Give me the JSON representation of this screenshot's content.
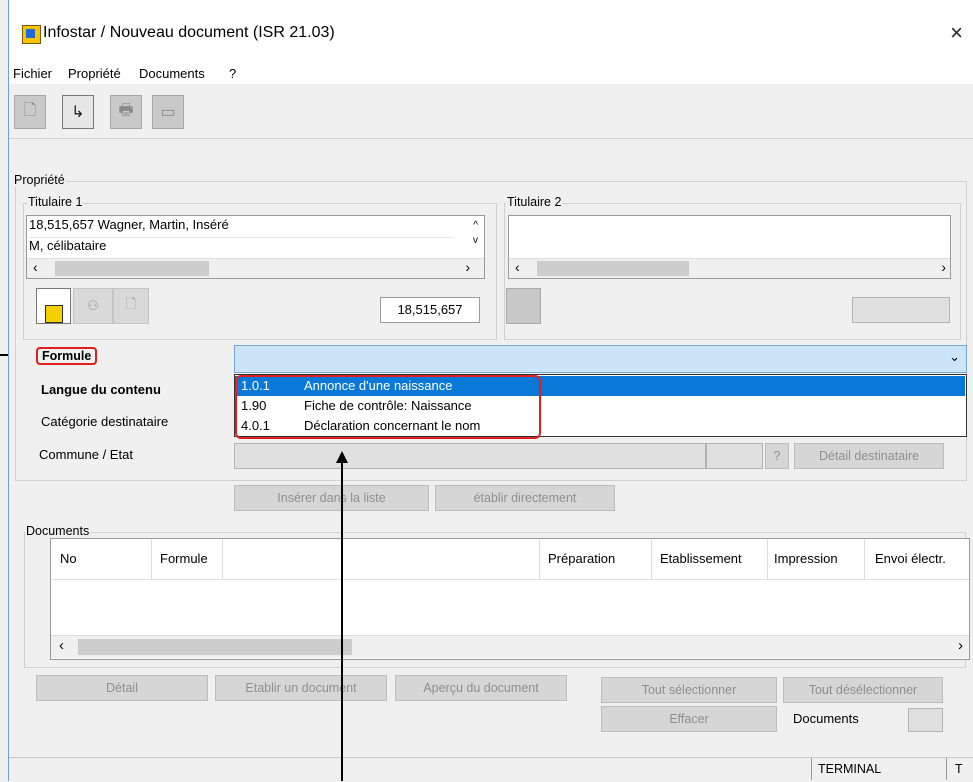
{
  "window": {
    "title": "Infostar / Nouveau document (ISR 21.03)",
    "close_glyph": "×"
  },
  "menu": [
    "Fichier",
    "Propriété",
    "Documents",
    "?"
  ],
  "toolbar": [
    {
      "icon": "new-document-icon",
      "glyph": "🗋"
    },
    {
      "icon": "exit-door-icon",
      "glyph": "↳"
    },
    {
      "icon": "printer-icon",
      "glyph": "🖶"
    },
    {
      "icon": "card-icon",
      "glyph": "▭"
    }
  ],
  "propriete": {
    "label": "Propriété",
    "titulaire1": {
      "label": "Titulaire 1",
      "line1": "18,515,657  Wagner, Martin, Inséré",
      "line2": "M, célibataire",
      "id": "18,515,657"
    },
    "titulaire2": {
      "label": "Titulaire 2",
      "id": ""
    }
  },
  "form": {
    "formule_label": "Formule",
    "langue_label": "Langue du contenu",
    "categorie_label": "Catégorie destinataire",
    "commune_label": "Commune / Etat",
    "commune_help": "?",
    "detail_destinataire": "Détail destinataire",
    "dropdown_value": "",
    "options": [
      {
        "code": "1.0.1",
        "text": "Annonce d'une naissance",
        "selected": true
      },
      {
        "code": "1.90",
        "text": "Fiche de contrôle: Naissance",
        "selected": false
      },
      {
        "code": "4.0.1",
        "text": "Déclaration concernant le nom",
        "selected": false
      }
    ]
  },
  "actions": {
    "inserer": "Insérer dans la liste",
    "etablir": "établir directement"
  },
  "documents": {
    "label": "Documents",
    "columns": [
      "No",
      "Formule",
      "",
      "Préparation",
      "Etablissement",
      "Impression",
      "Envoi électr."
    ]
  },
  "bottom": {
    "detail": "Détail",
    "etablir_doc": "Etablir un document",
    "apercu": "Aperçu du document",
    "tout_sel": "Tout sélectionner",
    "tout_desel": "Tout désélectionner",
    "effacer": "Effacer",
    "documents_label": "Documents",
    "documents_count": ""
  },
  "status": {
    "terminal": "TERMINAL",
    "t": "T"
  }
}
